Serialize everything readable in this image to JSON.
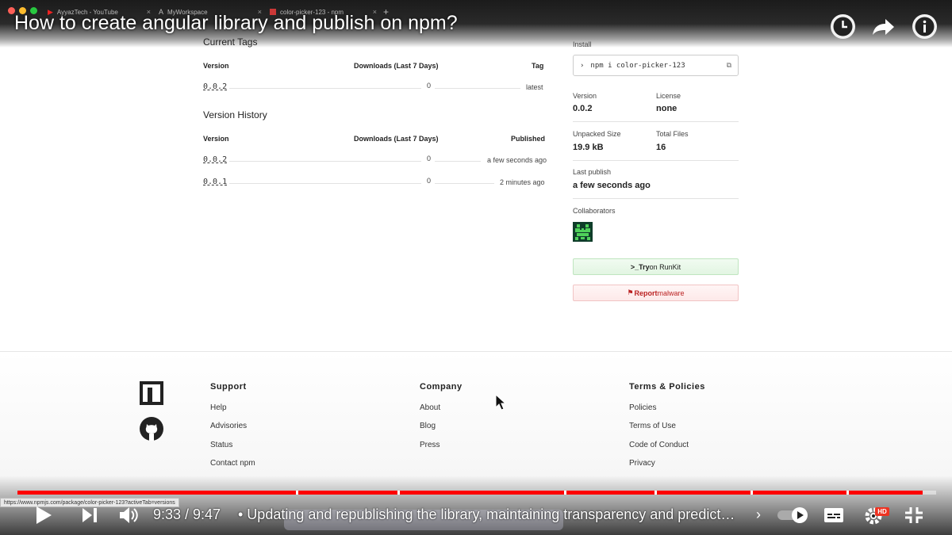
{
  "browser": {
    "tabs": [
      {
        "label": "AyyazTech - YouTube"
      },
      {
        "label": "MyWorkspace"
      },
      {
        "label": "color-picker-123 - npm"
      }
    ],
    "new_tab": "+"
  },
  "video": {
    "title": "How to create angular library and publish on npm?",
    "time": "9:33 / 9:47",
    "chapter": "• Updating and republishing the library, maintaining transparency and predict…",
    "chapter_arrow": "›",
    "hd": "HD",
    "progress_fraction": 0.985
  },
  "status_bar": {
    "url": "https://www.npmjs.com/package/color-picker-123?activeTab=versions"
  },
  "current_tags": {
    "title": "Current Tags",
    "headers": {
      "version": "Version",
      "downloads": "Downloads (Last 7 Days)",
      "tag": "Tag"
    },
    "rows": [
      {
        "version": "0.0.2",
        "downloads": "0",
        "tag": "latest"
      }
    ]
  },
  "version_history": {
    "title": "Version History",
    "headers": {
      "version": "Version",
      "downloads": "Downloads (Last 7 Days)",
      "published": "Published"
    },
    "rows": [
      {
        "version": "0.0.2",
        "downloads": "0",
        "published": "a few seconds ago"
      },
      {
        "version": "0.0.1",
        "downloads": "0",
        "published": "2 minutes ago"
      }
    ]
  },
  "sidebar": {
    "install_label": "Install",
    "install_prompt": "›",
    "install_cmd": "npm i color-picker-123",
    "version_label": "Version",
    "version_value": "0.0.2",
    "license_label": "License",
    "license_value": "none",
    "unpacked_label": "Unpacked Size",
    "unpacked_value": "19.9 kB",
    "files_label": "Total Files",
    "files_value": "16",
    "last_publish_label": "Last publish",
    "last_publish_value": "a few seconds ago",
    "collaborators_label": "Collaborators",
    "runkit_prefix": ">_",
    "runkit_try": "Try",
    "runkit_rest": " on RunKit",
    "report_prefix": "Report",
    "report_rest": " malware"
  },
  "footer": {
    "support": {
      "title": "Support",
      "links": [
        "Help",
        "Advisories",
        "Status",
        "Contact npm"
      ]
    },
    "company": {
      "title": "Company",
      "links": [
        "About",
        "Blog",
        "Press"
      ]
    },
    "policies": {
      "title": "Terms & Policies",
      "links": [
        "Policies",
        "Terms of Use",
        "Code of Conduct",
        "Privacy"
      ]
    }
  },
  "colors": {
    "progress": "#ff0000",
    "npm_red": "#cb3837",
    "runkit_green": "#e2f5e2",
    "malware_red": "#b22222"
  }
}
